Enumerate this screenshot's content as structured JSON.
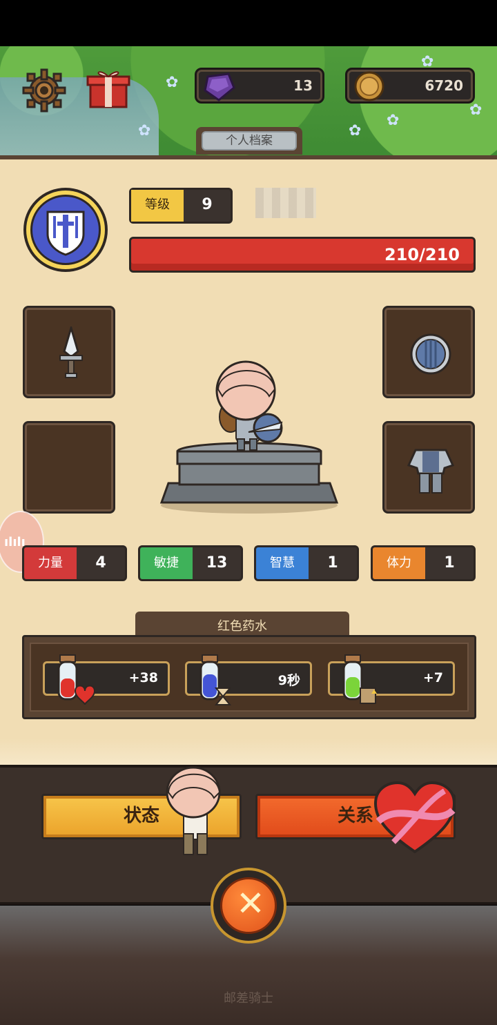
{
  "resources": {
    "gems": "13",
    "coins": "6720"
  },
  "header": {
    "tab_title": "个人档案"
  },
  "profile": {
    "level_label": "等级",
    "level_value": "9",
    "hp": "210/210"
  },
  "stats": [
    {
      "label": "力量",
      "value": "4",
      "color": "#d33a3a"
    },
    {
      "label": "敏捷",
      "value": "13",
      "color": "#3fb25a"
    },
    {
      "label": "智慧",
      "value": "1",
      "color": "#3b82d6"
    },
    {
      "label": "体力",
      "value": "1",
      "color": "#e9862e"
    }
  ],
  "potions": {
    "title": "红色药水",
    "items": [
      {
        "value": "+38",
        "icon": "health-potion-icon"
      },
      {
        "value": "9秒",
        "icon": "time-potion-icon"
      },
      {
        "value": "+7",
        "icon": "defense-potion-icon"
      }
    ]
  },
  "buttons": {
    "status": "状态",
    "relation": "关系"
  },
  "side_badge": "ılılı",
  "footer": {
    "title": "邮差骑士"
  }
}
